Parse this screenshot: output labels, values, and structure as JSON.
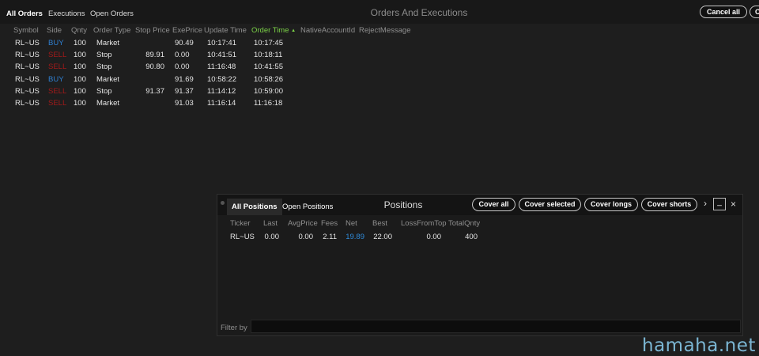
{
  "orders_window": {
    "tabs": [
      "All Orders",
      "Executions",
      "Open Orders"
    ],
    "title": "Orders And Executions",
    "cancel_all_label": "Cancel all",
    "clipped_button_label": "C",
    "columns": [
      "Symbol",
      "Side",
      "Qnty",
      "Order Type",
      "Stop Price",
      "ExePrice",
      "Update Time",
      "Order Time",
      "NativeAccountId",
      "RejectMessage"
    ],
    "sorted_column": "Order Time",
    "sort_indicator": "▲",
    "rows": [
      {
        "symbol": "RL~US",
        "side": "BUY",
        "qty": "100",
        "type": "Market",
        "stop": "",
        "exe": "90.49",
        "update": "10:17:41",
        "order_time": "10:17:45"
      },
      {
        "symbol": "RL~US",
        "side": "SELL",
        "qty": "100",
        "type": "Stop",
        "stop": "89.91",
        "exe": "0.00",
        "update": "10:41:51",
        "order_time": "10:18:11"
      },
      {
        "symbol": "RL~US",
        "side": "SELL",
        "qty": "100",
        "type": "Stop",
        "stop": "90.80",
        "exe": "0.00",
        "update": "11:16:48",
        "order_time": "10:41:55"
      },
      {
        "symbol": "RL~US",
        "side": "BUY",
        "qty": "100",
        "type": "Market",
        "stop": "",
        "exe": "91.69",
        "update": "10:58:22",
        "order_time": "10:58:26"
      },
      {
        "symbol": "RL~US",
        "side": "SELL",
        "qty": "100",
        "type": "Stop",
        "stop": "91.37",
        "exe": "91.37",
        "update": "11:14:12",
        "order_time": "10:59:00"
      },
      {
        "symbol": "RL~US",
        "side": "SELL",
        "qty": "100",
        "type": "Market",
        "stop": "",
        "exe": "91.03",
        "update": "11:16:14",
        "order_time": "11:16:18"
      }
    ]
  },
  "positions_window": {
    "tabs": [
      "All Positions",
      "Open Positions"
    ],
    "title": "Positions",
    "buttons": [
      "Cover all",
      "Cover selected",
      "Cover longs",
      "Cover shorts"
    ],
    "more_glyph": "›",
    "minimize_glyph": "_",
    "close_glyph": "×",
    "columns": [
      "Ticker",
      "Last",
      "AvgPrice",
      "Fees",
      "Net",
      "Best",
      "LossFromTop",
      "TotalQnty"
    ],
    "rows": [
      {
        "ticker": "RL~US",
        "last": "0.00",
        "avg": "0.00",
        "fees": "2.11",
        "net": "19.89",
        "best": "22.00",
        "loss": "0.00",
        "total": "400"
      }
    ],
    "filter_label": "Filter by",
    "filter_value": ""
  },
  "colors": {
    "buy": "#2f7fd0",
    "sell": "#a11a1a",
    "sorted_header": "#7bd147",
    "net": "#2f8ad8"
  },
  "watermark": "hamaha.net"
}
